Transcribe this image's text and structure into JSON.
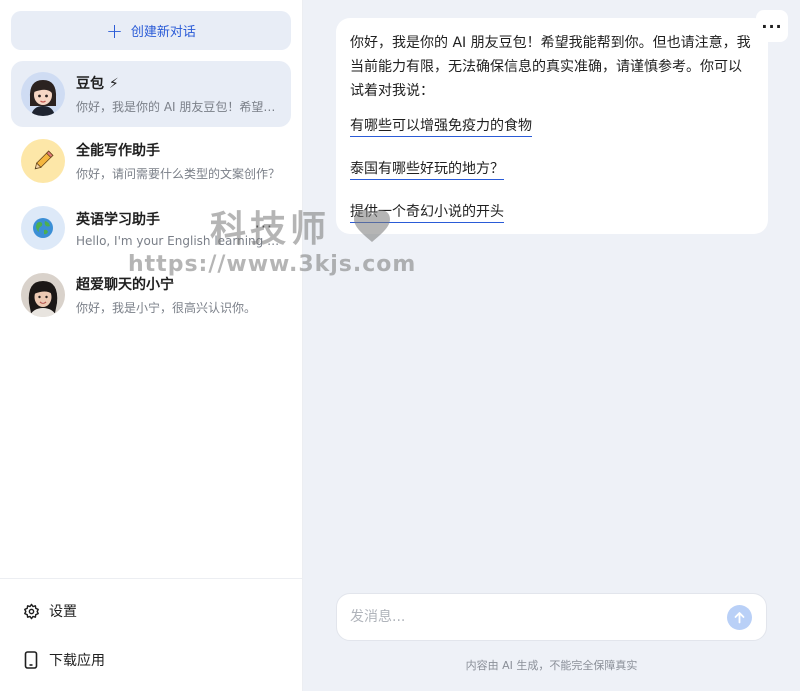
{
  "sidebar": {
    "new_chat_label": "创建新对话",
    "conversations": [
      {
        "name": "豆包 ⚡",
        "preview": "你好，我是你的 AI 朋友豆包！希望我能帮到你。",
        "avatar": "doubao-girl-avatar"
      },
      {
        "name": "全能写作助手",
        "preview": "你好，请问需要什么类型的文案创作？",
        "avatar": "pencil-icon"
      },
      {
        "name": "英语学习助手",
        "preview": "Hello, I'm your English learning assistant.",
        "avatar": "globe-icon"
      },
      {
        "name": "超爱聊天的小宁",
        "preview": "你好，我是小宁，很高兴认识你。",
        "avatar": "girl-photo-avatar"
      }
    ],
    "more_label": "···",
    "settings_label": "设置",
    "download_label": "下载应用"
  },
  "chat": {
    "menu_label": "···",
    "intro": "你好，我是你的 AI 朋友豆包！希望我能帮到你。但也请注意，我当前能力有限，无法确保信息的真实准确，请谨慎参考。你可以试着对我说：",
    "suggestions": [
      "有哪些可以增强免疫力的食物",
      "泰国有哪些好玩的地方？",
      "提供一个奇幻小说的开头"
    ]
  },
  "input": {
    "placeholder": "发消息...",
    "disclaimer": "内容由 AI 生成，不能完全保障真实"
  },
  "watermark": {
    "title": "科技师",
    "url": "https://www.3kjs.com"
  },
  "colors": {
    "accent": "#2a5bd7",
    "active_item_bg": "#e8edf6",
    "main_bg": "#eef1f7",
    "send_button": "#b9d0f7"
  }
}
